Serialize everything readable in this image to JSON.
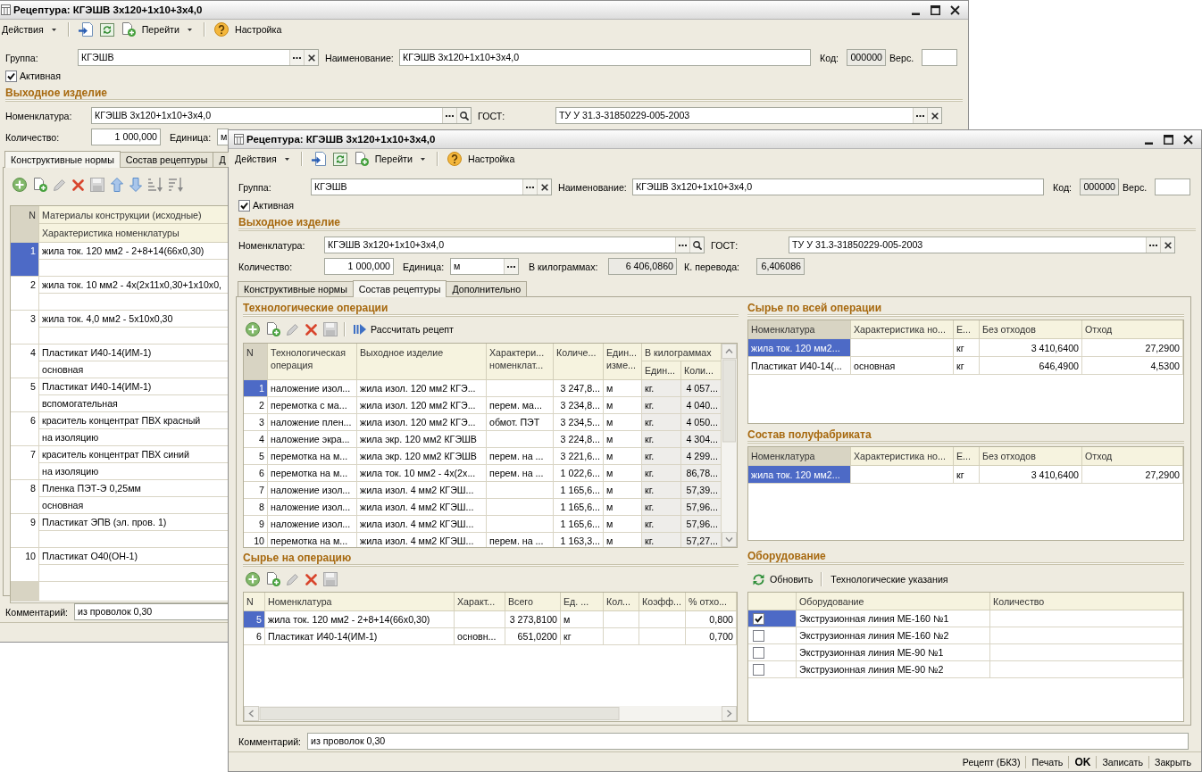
{
  "back_window": {
    "title": "Рецептура: КГЭШВ 3х120+1х10+3х4,0",
    "toolbar": {
      "actions": "Действия",
      "goto": "Перейти",
      "settings": "Настройка"
    },
    "group": {
      "kind": "choice_clear",
      "label": "Группа:",
      "value": "КГЭШВ"
    },
    "name": {
      "kind": "text",
      "label": "Наименование:",
      "value": "КГЭШВ 3х120+1х10+3х4,0"
    },
    "code": {
      "kind": "readonly",
      "label": "Код:",
      "value": "000000"
    },
    "version": {
      "kind": "text",
      "label": "Верс."
    },
    "active": {
      "label": "Активная",
      "checked": true
    },
    "output_product": {
      "title": "Выходное изделие",
      "nomenclature": {
        "kind": "choice_search",
        "label": "Номенклатура:",
        "value": "КГЭШВ 3х120+1х10+3х4,0"
      },
      "gost": {
        "kind": "choice_clear",
        "label": "ГОСТ:",
        "value": "ТУ У 31.3-31850229-005-2003"
      },
      "quantity": {
        "kind": "number",
        "label": "Количество:",
        "value": "1 000,000"
      },
      "unit": {
        "kind": "text",
        "label": "Единица:",
        "value": "м"
      }
    },
    "tabs": [
      {
        "label": "Конструктивные нормы",
        "selected": true
      },
      {
        "label": "Состав рецептуры",
        "selected": false
      },
      {
        "label": "Д",
        "selected": false
      }
    ],
    "components_table": {
      "columns": [
        "N",
        "Материалы конструкции (исходные)",
        "Характеристика номенклатуры"
      ],
      "rows": [
        {
          "n": "1",
          "material": "жила ток. 120 мм2 - 2+8+14(66х0,30)",
          "selected": true
        },
        {
          "n": "2",
          "material": "жила ток. 10 мм2 - 4х(2х11х0,30+1х10х0,",
          "selected": false
        },
        {
          "n": "3",
          "material": "жила ток. 4,0 мм2 - 5х10х0,30",
          "selected": false
        },
        {
          "n": "4",
          "material": "Пластикат И40-14(ИМ-1)",
          "characteristic": "основная",
          "selected": false
        },
        {
          "n": "5",
          "material": "Пластикат И40-14(ИМ-1)",
          "characteristic": "вспомогательная",
          "selected": false
        },
        {
          "n": "6",
          "material": "краситель концентрат ПВХ красный",
          "characteristic": "на изоляцию",
          "selected": false
        },
        {
          "n": "7",
          "material": "краситель концентрат ПВХ синий",
          "characteristic": "на изоляцию",
          "selected": false
        },
        {
          "n": "8",
          "material": "Пленка ПЭТ-Э 0,25мм",
          "characteristic": "основная",
          "selected": false
        },
        {
          "n": "9",
          "material": "Пластикат ЭПВ (эл. пров. 1)",
          "selected": false
        },
        {
          "n": "10",
          "material": "Пластикат О40(ОН-1)",
          "selected": false
        }
      ]
    },
    "comment": {
      "kind": "text",
      "label": "Комментарий:",
      "value": "из проволок 0,30"
    }
  },
  "front_window": {
    "title": "Рецептура: КГЭШВ 3х120+1х10+3х4,0",
    "toolbar": {
      "actions": "Действия",
      "goto": "Перейти",
      "settings": "Настройка"
    },
    "group": {
      "kind": "choice_clear",
      "label": "Группа:",
      "value": "КГЭШВ"
    },
    "name": {
      "kind": "text",
      "label": "Наименование:",
      "value": "КГЭШВ 3х120+1х10+3х4,0"
    },
    "code": {
      "kind": "readonly",
      "label": "Код:",
      "value": "000000"
    },
    "version": {
      "kind": "text",
      "label": "Верс."
    },
    "active": {
      "label": "Активная",
      "checked": true
    },
    "output_product": {
      "title": "Выходное изделие",
      "nomenclature": {
        "kind": "choice_search",
        "label": "Номенклатура:",
        "value": "КГЭШВ 3х120+1х10+3х4,0"
      },
      "gost": {
        "kind": "choice_clear",
        "label": "ГОСТ:",
        "value": "ТУ У 31.3-31850229-005-2003"
      },
      "quantity": {
        "kind": "number",
        "label": "Количество:",
        "value": "1 000,000"
      },
      "unit": {
        "kind": "choice",
        "label": "Единица:",
        "value": "м"
      },
      "weight_kg": {
        "kind": "readonly",
        "label": "В килограммах:",
        "value": "6 406,0860"
      },
      "conversion": {
        "kind": "readonly",
        "label": "К. перевода:",
        "value": "6,406086"
      }
    },
    "tabs": [
      {
        "label": "Конструктивные нормы",
        "selected": false
      },
      {
        "label": "Состав рецептуры",
        "selected": true
      },
      {
        "label": "Дополнительно",
        "selected": false
      }
    ],
    "operations": {
      "title": "Технологические операции",
      "calculate_button": "Рассчитать рецепт",
      "columns": [
        "N",
        "Технологическая операция",
        "Выходное изделие",
        "Характери... номенклат...",
        "Количе...",
        "Един... изме...",
        "Един...",
        "Коли..."
      ],
      "kg_group": "В килограммах",
      "rows": [
        {
          "n": "1",
          "operation": "наложение изол...",
          "output": "жила изол. 120 мм2 КГЭ...",
          "quantity": "3 247,8...",
          "unit": "м",
          "kg_unit": "кг.",
          "kg_quantity": "4 057...",
          "selected": true
        },
        {
          "n": "2",
          "operation": "перемотка с ма...",
          "output": "жила изол. 120 мм2 КГЭ...",
          "characteristic": "перем. ма...",
          "quantity": "3 234,8...",
          "unit": "м",
          "kg_unit": "кг.",
          "kg_quantity": "4 040...",
          "selected": false
        },
        {
          "n": "3",
          "operation": "наложение плен...",
          "output": "жила изол. 120 мм2 КГЭ...",
          "characteristic": "обмот. ПЭТ",
          "quantity": "3 234,5...",
          "unit": "м",
          "kg_unit": "кг.",
          "kg_quantity": "4 050...",
          "selected": false
        },
        {
          "n": "4",
          "operation": "наложение экра...",
          "output": "жила экр. 120 мм2 КГЭШВ",
          "quantity": "3 224,8...",
          "unit": "м",
          "kg_unit": "кг.",
          "kg_quantity": "4 304...",
          "selected": false
        },
        {
          "n": "5",
          "operation": "перемотка на м...",
          "output": "жила экр. 120 мм2 КГЭШВ",
          "characteristic": "перем. на ...",
          "quantity": "3 221,6...",
          "unit": "м",
          "kg_unit": "кг.",
          "kg_quantity": "4 299...",
          "selected": false
        },
        {
          "n": "6",
          "operation": "перемотка на м...",
          "output": "жила ток. 10 мм2 - 4х(2х...",
          "characteristic": "перем. на ...",
          "quantity": "1 022,6...",
          "unit": "м",
          "kg_unit": "кг.",
          "kg_quantity": "86,78...",
          "selected": false
        },
        {
          "n": "7",
          "operation": "наложение изол...",
          "output": "жила изол. 4 мм2 КГЭШ...",
          "quantity": "1 165,6...",
          "unit": "м",
          "kg_unit": "кг.",
          "kg_quantity": "57,39...",
          "selected": false
        },
        {
          "n": "8",
          "operation": "наложение изол...",
          "output": "жила изол. 4 мм2 КГЭШ...",
          "quantity": "1 165,6...",
          "unit": "м",
          "kg_unit": "кг.",
          "kg_quantity": "57,96...",
          "selected": false
        },
        {
          "n": "9",
          "operation": "наложение изол...",
          "output": "жила изол. 4 мм2 КГЭШ...",
          "quantity": "1 165,6...",
          "unit": "м",
          "kg_unit": "кг.",
          "kg_quantity": "57,96...",
          "selected": false
        },
        {
          "n": "10",
          "operation": "перемотка на м...",
          "output": "жила изол. 4 мм2 КГЭШ...",
          "characteristic": "перем. на ...",
          "quantity": "1 163,3...",
          "unit": "м",
          "kg_unit": "кг.",
          "kg_quantity": "57,27...",
          "selected": false
        }
      ]
    },
    "raw_materials": {
      "title": "Сырье на операцию",
      "columns": [
        "N",
        "Номенклатура",
        "Характ...",
        "Всего",
        "Ед. ...",
        "Кол...",
        "Коэфф...",
        "% отхо..."
      ],
      "rows": [
        {
          "n": "5",
          "nomenclature": "жила ток. 120 мм2 - 2+8+14(66х0,30)",
          "total": "3 273,8100",
          "unit": "м",
          "waste_percent": "0,800",
          "selected": true
        },
        {
          "n": "6",
          "nomenclature": "Пластикат И40-14(ИМ-1)",
          "characteristic": "основн...",
          "total": "651,0200",
          "unit": "кг",
          "waste_percent": "0,700",
          "selected": false
        }
      ]
    },
    "operation_totals": {
      "title": "Сырье по всей операции",
      "columns": [
        "Номенклатура",
        "Характеристика но...",
        "Е...",
        "Без отходов",
        "Отход"
      ],
      "rows": [
        {
          "nomenclature": "жила ток. 120 мм2...",
          "unit": "кг",
          "net": "3 410,6400",
          "waste": "27,2900",
          "selected": true
        },
        {
          "nomenclature": "Пластикат И40-14(...",
          "characteristic": "основная",
          "unit": "кг",
          "net": "646,4900",
          "waste": "4,5300",
          "selected": false
        }
      ]
    },
    "semi_product": {
      "title": "Состав полуфабриката",
      "columns": [
        "Номенклатура",
        "Характеристика но...",
        "Е...",
        "Без отходов",
        "Отход"
      ],
      "rows": [
        {
          "nomenclature": "жила ток. 120 мм2...",
          "unit": "кг",
          "net": "3 410,6400",
          "waste": "27,2900",
          "selected": true
        }
      ]
    },
    "equipment": {
      "title": "Оборудование",
      "refresh_button": "Обновить",
      "instructions_button": "Технологические указания",
      "columns": [
        "Оборудование",
        "Количество"
      ],
      "rows": [
        {
          "name": "Экструзионная линия МЕ-160 №1",
          "checked": true,
          "selected": true
        },
        {
          "name": "Экструзионная линия МЕ-160 №2",
          "checked": false,
          "selected": false
        },
        {
          "name": "Экструзионная линия МЕ-90 №1",
          "checked": false,
          "selected": false
        },
        {
          "name": "Экструзионная линия МЕ-90 №2",
          "checked": false,
          "selected": false
        }
      ]
    },
    "comment": {
      "kind": "text",
      "label": "Комментарий:",
      "value": "из проволок 0,30"
    },
    "status_buttons": [
      {
        "label": "Рецепт (БКЗ)",
        "default": false
      },
      {
        "label": "Печать",
        "default": false
      },
      {
        "label": "OK",
        "default": true
      },
      {
        "label": "Записать",
        "default": false
      },
      {
        "label": "Закрыть",
        "default": false
      }
    ]
  }
}
